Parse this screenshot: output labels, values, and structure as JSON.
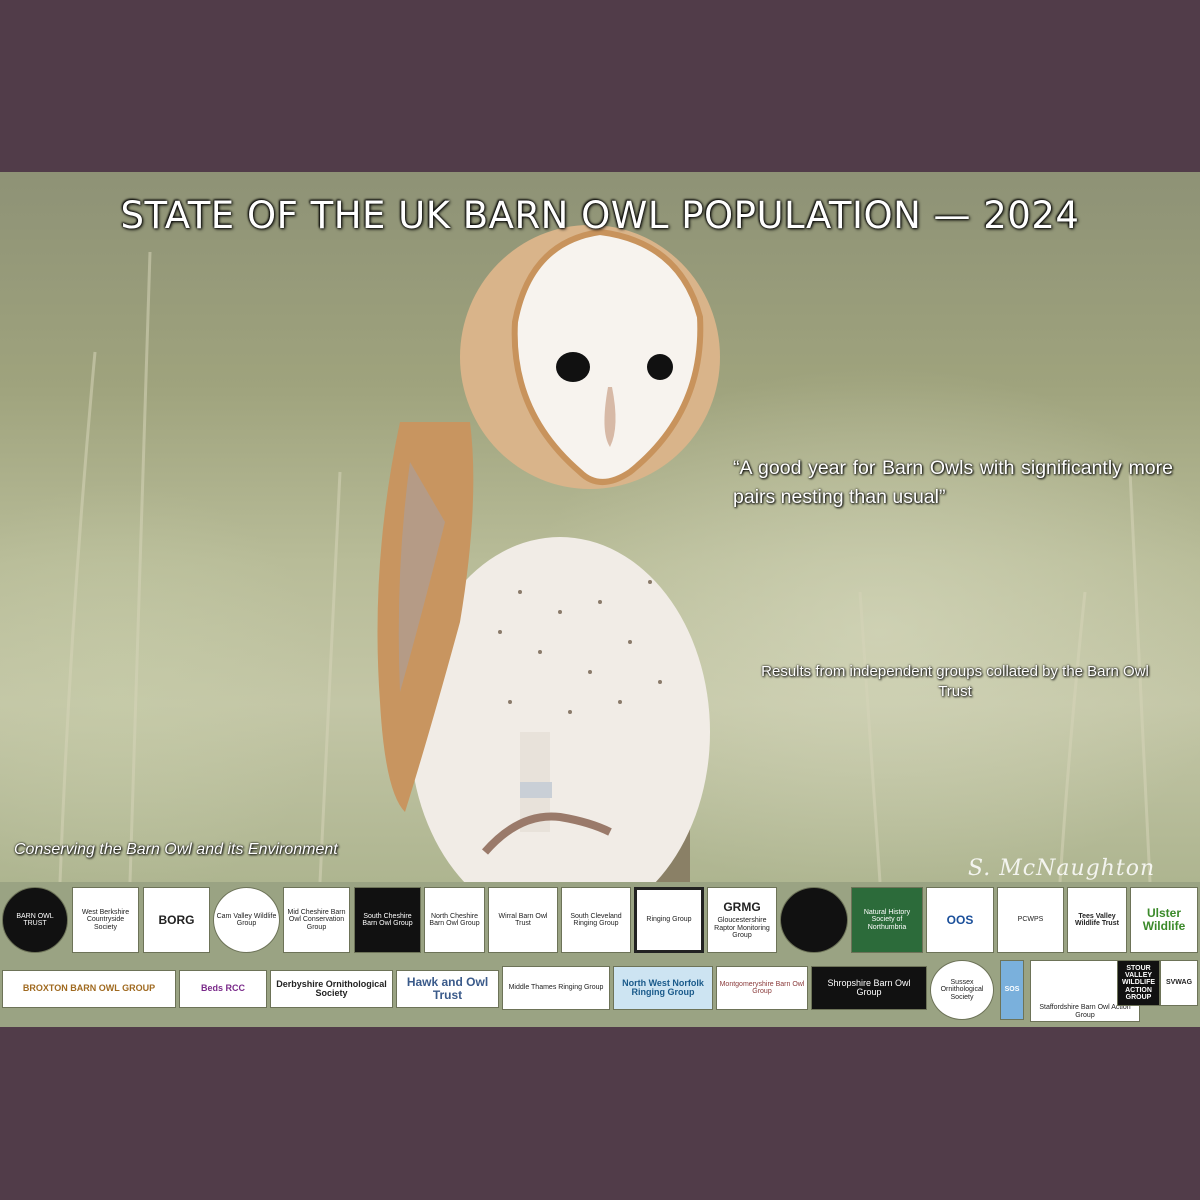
{
  "title": "STATE OF THE UK BARN OWL POPULATION — 2024",
  "quote": "“A good year for Barn Owls with significantly more pairs nesting than usual”",
  "results": "Results from independent groups collated by the Barn Owl Trust",
  "tagline": "Conserving the Barn Owl and its Environment",
  "signature": "S. McNaughton",
  "logos": {
    "row1": [
      {
        "name": "barn-owl-trust-logo",
        "text": "BARN OWL TRUST"
      },
      {
        "name": "west-berkshire-logo",
        "text": "West Berkshire Countryside Society"
      },
      {
        "name": "borg-logo",
        "text": "BORG"
      },
      {
        "name": "cam-valley-logo",
        "text": "Cam Valley Wildlife Group"
      },
      {
        "name": "mid-cheshire-logo",
        "text": "Mid Cheshire Barn Owl Conservation Group"
      },
      {
        "name": "south-cheshire-logo",
        "text": "South Cheshire Barn Owl Group"
      },
      {
        "name": "north-cheshire-logo",
        "text": "North Cheshire Barn Owl Group"
      },
      {
        "name": "wirral-logo",
        "text": "Wirral Barn Owl Trust"
      },
      {
        "name": "south-cleveland-logo",
        "text": "South Cleveland Ringing Group"
      },
      {
        "name": "ringing-group-logo",
        "text": "Ringing Group"
      },
      {
        "name": "grmg-logo",
        "text": "GRMG",
        "sub": "Gloucestershire Raptor Monitoring Group"
      },
      {
        "name": "round-logo",
        "text": ""
      },
      {
        "name": "natural-history-logo",
        "text": "Natural History Society of Northumbria"
      },
      {
        "name": "oos-logo",
        "text": "OOS"
      },
      {
        "name": "pcwps-logo",
        "text": "PCWPS"
      },
      {
        "name": "tees-valley-logo",
        "text": "Tees Valley Wildlife Trust"
      },
      {
        "name": "ulster-wildlife-logo",
        "text": "Ulster Wildlife"
      }
    ],
    "row2": [
      {
        "name": "broxton-logo",
        "text": "BROXTON BARN OWL GROUP"
      },
      {
        "name": "rcc-logo",
        "text": "Beds RCC"
      },
      {
        "name": "derbyshire-logo",
        "text": "Derbyshire Ornithological Society"
      },
      {
        "name": "hawk-owl-trust-logo",
        "text": "Hawk and Owl Trust"
      },
      {
        "name": "middle-thames-logo",
        "text": "Middle Thames Ringing Group"
      },
      {
        "name": "north-west-norfolk-logo",
        "text": "North West Norfolk Ringing Group"
      },
      {
        "name": "montgomeryshire-logo",
        "text": "Montgomeryshire Barn Owl Group"
      },
      {
        "name": "shropshire-logo",
        "text": "Shropshire Barn Owl Group"
      },
      {
        "name": "sussex-logo",
        "text": "Sussex Ornithological Society"
      },
      {
        "name": "sos-logo",
        "text": "SOS"
      },
      {
        "name": "staffordshire-logo",
        "text": "Staffordshire Barn Owl Action Group"
      },
      {
        "name": "stour-valley-logo",
        "text": "STOUR VALLEY WILDLIFE ACTION GROUP"
      },
      {
        "name": "svwag-logo",
        "text": "SVWAG"
      }
    ]
  },
  "colors": {
    "frame": "#513c49",
    "strip": "#9aa383",
    "owl_face": "#f7f3ee",
    "owl_back": "#d9b48a"
  }
}
